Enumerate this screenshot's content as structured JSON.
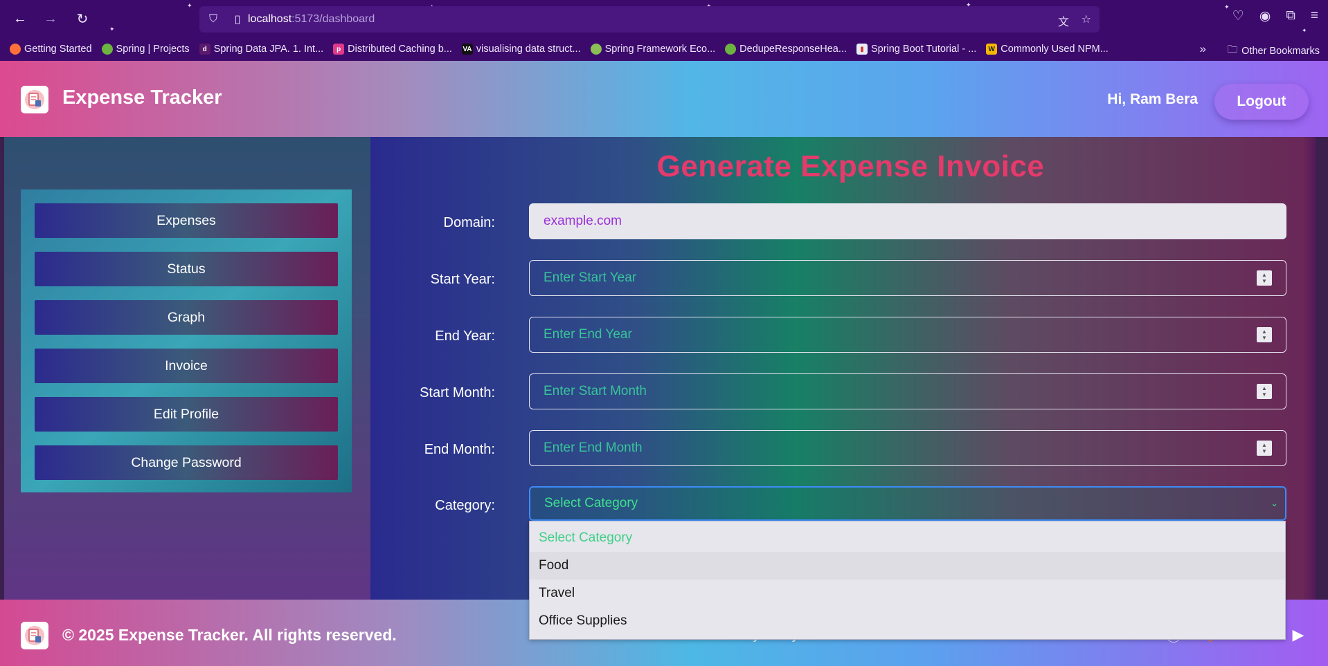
{
  "browser": {
    "url_host": "localhost",
    "url_path": ":5173/dashboard",
    "bookmarks": [
      {
        "label": "Getting Started",
        "icon": "firefox-icon",
        "color": "#ff7139"
      },
      {
        "label": "Spring | Projects",
        "icon": "spring-icon",
        "color": "#6db33f"
      },
      {
        "label": "Spring Data JPA. 1. Int...",
        "icon": "jpa-icon",
        "color": "#5b1a6b"
      },
      {
        "label": "Distributed Caching b...",
        "icon": "cache-icon",
        "color": "#e03a8a"
      },
      {
        "label": "visualising data struct...",
        "icon": "visualgo-icon",
        "color": "#111111"
      },
      {
        "label": "Spring Framework Eco...",
        "icon": "leaf-icon",
        "color": "#8bbf56"
      },
      {
        "label": "DedupeResponseHea...",
        "icon": "spring-icon",
        "color": "#6db33f"
      },
      {
        "label": "Spring Boot Tutorial - ...",
        "icon": "chart-icon",
        "color": "#e8eef8"
      },
      {
        "label": "Commonly Used NPM...",
        "icon": "w3-icon",
        "color": "#f5b800"
      }
    ],
    "other_bookmarks": "Other Bookmarks"
  },
  "header": {
    "title": "Expense Tracker",
    "greeting": "Hi, Ram Bera",
    "logout_label": "Logout"
  },
  "sidebar": {
    "items": [
      {
        "label": "Expenses"
      },
      {
        "label": "Status"
      },
      {
        "label": "Graph"
      },
      {
        "label": "Invoice"
      },
      {
        "label": "Edit Profile"
      },
      {
        "label": "Change Password"
      }
    ]
  },
  "form": {
    "title": "Generate Expense Invoice",
    "domain": {
      "label": "Domain:",
      "value": "example.com"
    },
    "start_year": {
      "label": "Start Year:",
      "placeholder": "Enter Start Year"
    },
    "end_year": {
      "label": "End Year:",
      "placeholder": "Enter End Year"
    },
    "start_month": {
      "label": "Start Month:",
      "placeholder": "Enter Start Month"
    },
    "end_month": {
      "label": "End Month:",
      "placeholder": "Enter End Month"
    },
    "category": {
      "label": "Category:",
      "selected": "Select Category",
      "options": [
        "Select Category",
        "Food",
        "Travel",
        "Office Supplies"
      ]
    }
  },
  "footer": {
    "copyright": "© 2025 Expense Tracker. All rights reserved.",
    "links": [
      "About",
      "Privacy Policy",
      "Contact"
    ],
    "social_icons": [
      "facebook-icon",
      "twitter-icon",
      "linkedin-icon",
      "youtube-icon"
    ]
  },
  "colors": {
    "title_accent": "#e53a6b",
    "placeholder_green": "#38c49a",
    "domain_value": "#9b30d9"
  }
}
